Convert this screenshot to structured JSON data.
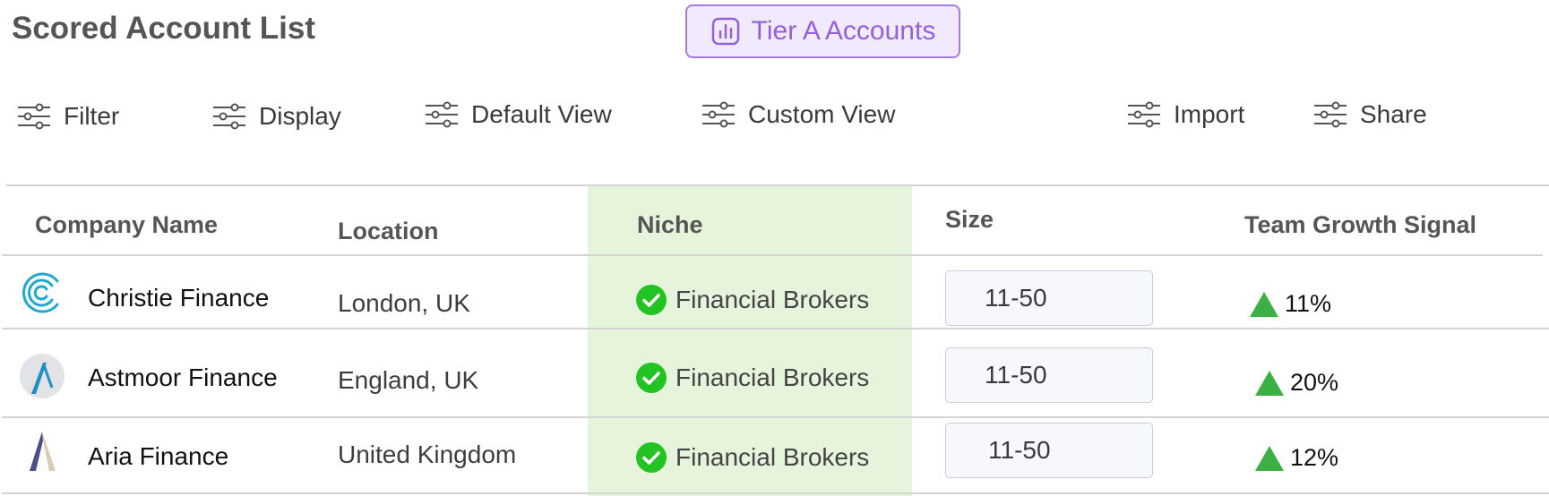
{
  "header": {
    "title": "Scored Account List",
    "tier_button_label": "Tier A Accounts",
    "tier_button_icon": "bar-chart-icon",
    "accent_color": "#9461dc"
  },
  "toolbar": {
    "icon": "sliders-icon",
    "items": [
      "Filter",
      "Display",
      "Default View",
      "Custom View",
      "Import",
      "Share"
    ]
  },
  "table": {
    "columns": [
      "Company Name",
      "Location",
      "Niche",
      "Size",
      "Team Growth Signal"
    ],
    "highlight_column": "Niche",
    "highlight_color": "#e6f4dc",
    "rows": [
      {
        "company": "Christie Finance",
        "logo": "christie-logo",
        "location": "London, UK",
        "niche": "Financial Brokers",
        "size": "11-50",
        "growth": "11%",
        "growth_direction": "up"
      },
      {
        "company": "Astmoor Finance",
        "logo": "astmoor-logo",
        "location": "England, UK",
        "niche": "Financial Brokers",
        "size": "11-50",
        "growth": "20%",
        "growth_direction": "up"
      },
      {
        "company": "Aria Finance",
        "logo": "aria-logo",
        "location": "United Kingdom",
        "niche": "Financial Brokers",
        "size": "11-50",
        "growth": "12%",
        "growth_direction": "up"
      }
    ],
    "check_color": "#22c322",
    "up_arrow_color": "#3cb043"
  }
}
